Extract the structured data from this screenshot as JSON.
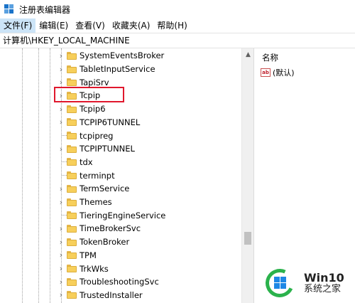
{
  "window": {
    "title": "注册表编辑器"
  },
  "menu": [
    "文件(F)",
    "编辑(E)",
    "查看(V)",
    "收藏夹(A)",
    "帮助(H)"
  ],
  "address": "计算机\\HKEY_LOCAL_MACHINE",
  "tree": {
    "items": [
      {
        "label": "SystemEventsBroker",
        "expandable": true
      },
      {
        "label": "TabletInputService",
        "expandable": true
      },
      {
        "label": "TapiSrv",
        "expandable": true
      },
      {
        "label": "Tcpip",
        "expandable": true,
        "highlighted": true
      },
      {
        "label": "Tcpip6",
        "expandable": true
      },
      {
        "label": "TCPIP6TUNNEL",
        "expandable": true
      },
      {
        "label": "tcpipreg",
        "expandable": false
      },
      {
        "label": "TCPIPTUNNEL",
        "expandable": true
      },
      {
        "label": "tdx",
        "expandable": false
      },
      {
        "label": "terminpt",
        "expandable": false
      },
      {
        "label": "TermService",
        "expandable": true
      },
      {
        "label": "Themes",
        "expandable": true
      },
      {
        "label": "TieringEngineService",
        "expandable": false
      },
      {
        "label": "TimeBrokerSvc",
        "expandable": true
      },
      {
        "label": "TokenBroker",
        "expandable": true
      },
      {
        "label": "TPM",
        "expandable": true
      },
      {
        "label": "TrkWks",
        "expandable": true
      },
      {
        "label": "TroubleshootingSvc",
        "expandable": true
      },
      {
        "label": "TrustedInstaller",
        "expandable": true
      }
    ]
  },
  "values_pane": {
    "column_header": "名称",
    "rows": [
      {
        "icon": "ab",
        "name": "(默认)"
      }
    ]
  },
  "watermark": {
    "title": "Win10",
    "subtitle": "系统之家"
  },
  "colors": {
    "highlight_box": "#e0182d",
    "folder": "#f7cf5b",
    "menu_active": "#cce4f7"
  }
}
